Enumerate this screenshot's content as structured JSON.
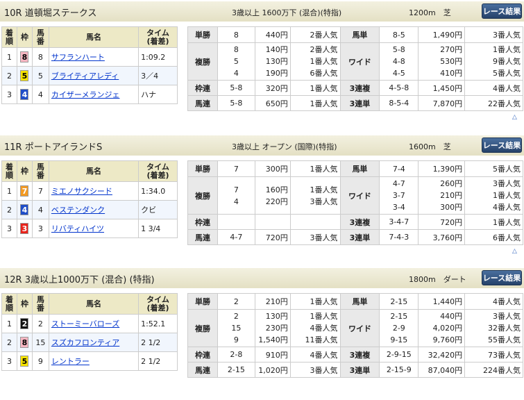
{
  "button_label": "レース結果",
  "races": [
    {
      "title": "10R 道頓堀ステークス",
      "conditions": "3歳以上 1600万下 (混合)(特指)",
      "distance": "1200m　芝",
      "headers": [
        "着順",
        "枠",
        "馬番",
        "馬名",
        "タイム (着差)"
      ],
      "horses": [
        {
          "pos": "1",
          "waku": "8",
          "num": "8",
          "name": "サフランハート",
          "time": "1:09.2"
        },
        {
          "pos": "2",
          "waku": "5",
          "num": "5",
          "name": "ブライティアレディ",
          "time": "3／4"
        },
        {
          "pos": "3",
          "waku": "4",
          "num": "4",
          "name": "カイザーメランジェ",
          "time": "ハナ"
        }
      ],
      "pay": {
        "tansho": {
          "label": "単勝",
          "num": "8",
          "yen": "440円",
          "pop": "2番人気"
        },
        "fukusho": {
          "label": "複勝",
          "nums": [
            "8",
            "5",
            "4"
          ],
          "yens": [
            "140円",
            "130円",
            "190円"
          ],
          "pops": [
            "2番人気",
            "1番人気",
            "6番人気"
          ]
        },
        "wakuren": {
          "label": "枠連",
          "num": "5-8",
          "yen": "320円",
          "pop": "1番人気"
        },
        "umaren": {
          "label": "馬連",
          "num": "5-8",
          "yen": "650円",
          "pop": "1番人気"
        },
        "umatan": {
          "label": "馬単",
          "num": "8-5",
          "yen": "1,490円",
          "pop": "3番人気"
        },
        "wide": {
          "label": "ワイド",
          "nums": [
            "5-8",
            "4-8",
            "4-5"
          ],
          "yens": [
            "270円",
            "530円",
            "410円"
          ],
          "pops": [
            "1番人気",
            "9番人気",
            "5番人気"
          ]
        },
        "sanrenpuku": {
          "label": "3連複",
          "num": "4-5-8",
          "yen": "1,450円",
          "pop": "4番人気"
        },
        "sanrentan": {
          "label": "3連単",
          "num": "8-5-4",
          "yen": "7,870円",
          "pop": "22番人気"
        }
      }
    },
    {
      "title": "11R ポートアイランドS",
      "conditions": "3歳以上 オープン (国際)(特指)",
      "distance": "1600m　芝",
      "headers": [
        "着順",
        "枠",
        "馬番",
        "馬名",
        "タイム (着差)"
      ],
      "horses": [
        {
          "pos": "1",
          "waku": "7",
          "num": "7",
          "name": "ミエノサクシード",
          "time": "1:34.0"
        },
        {
          "pos": "2",
          "waku": "4",
          "num": "4",
          "name": "ベステンダンク",
          "time": "クビ"
        },
        {
          "pos": "3",
          "waku": "3",
          "num": "3",
          "name": "リバティハイツ",
          "time": "1 3/4"
        }
      ],
      "pay": {
        "tansho": {
          "label": "単勝",
          "num": "7",
          "yen": "300円",
          "pop": "1番人気"
        },
        "fukusho": {
          "label": "複勝",
          "nums": [
            "7",
            "4"
          ],
          "yens": [
            "160円",
            "220円"
          ],
          "pops": [
            "1番人気",
            "3番人気"
          ]
        },
        "wakuren": {
          "label": "枠連",
          "num": "",
          "yen": "",
          "pop": ""
        },
        "umaren": {
          "label": "馬連",
          "num": "4-7",
          "yen": "720円",
          "pop": "3番人気"
        },
        "umatan": {
          "label": "馬単",
          "num": "7-4",
          "yen": "1,390円",
          "pop": "5番人気"
        },
        "wide": {
          "label": "ワイド",
          "nums": [
            "4-7",
            "3-7",
            "3-4"
          ],
          "yens": [
            "260円",
            "210円",
            "300円"
          ],
          "pops": [
            "3番人気",
            "1番人気",
            "4番人気"
          ]
        },
        "sanrenpuku": {
          "label": "3連複",
          "num": "3-4-7",
          "yen": "720円",
          "pop": "1番人気"
        },
        "sanrentan": {
          "label": "3連単",
          "num": "7-4-3",
          "yen": "3,760円",
          "pop": "6番人気"
        }
      }
    },
    {
      "title": "12R 3歳以上1000万下 (混合) (特指)",
      "conditions": "",
      "distance": "1800m　ダート",
      "headers": [
        "着順",
        "枠",
        "馬番",
        "馬名",
        "タイム (着差)"
      ],
      "horses": [
        {
          "pos": "1",
          "waku": "2",
          "num": "2",
          "name": "ストーミーバローズ",
          "time": "1:52.1"
        },
        {
          "pos": "2",
          "waku": "8",
          "num": "15",
          "name": "スズカフロンティア",
          "time": "2 1/2"
        },
        {
          "pos": "3",
          "waku": "5",
          "num": "9",
          "name": "レントラー",
          "time": "2 1/2"
        }
      ],
      "pay": {
        "tansho": {
          "label": "単勝",
          "num": "2",
          "yen": "210円",
          "pop": "1番人気"
        },
        "fukusho": {
          "label": "複勝",
          "nums": [
            "2",
            "15",
            "9"
          ],
          "yens": [
            "130円",
            "230円",
            "1,540円"
          ],
          "pops": [
            "1番人気",
            "4番人気",
            "11番人気"
          ]
        },
        "wakuren": {
          "label": "枠連",
          "num": "2-8",
          "yen": "910円",
          "pop": "4番人気"
        },
        "umaren": {
          "label": "馬連",
          "num": "2-15",
          "yen": "1,020円",
          "pop": "3番人気"
        },
        "umatan": {
          "label": "馬単",
          "num": "2-15",
          "yen": "1,440円",
          "pop": "4番人気"
        },
        "wide": {
          "label": "ワイド",
          "nums": [
            "2-15",
            "2-9",
            "9-15"
          ],
          "yens": [
            "440円",
            "4,020円",
            "9,760円"
          ],
          "pops": [
            "3番人気",
            "32番人気",
            "55番人気"
          ]
        },
        "sanrenpuku": {
          "label": "3連複",
          "num": "2-9-15",
          "yen": "32,420円",
          "pop": "73番人気"
        },
        "sanrentan": {
          "label": "3連単",
          "num": "2-15-9",
          "yen": "87,040円",
          "pop": "224番人気"
        }
      }
    }
  ],
  "waku_colors": {
    "1": {
      "bg": "#ffffff",
      "fg": "#000000"
    },
    "2": {
      "bg": "#111111",
      "fg": "#ffffff"
    },
    "3": {
      "bg": "#e8231b",
      "fg": "#ffffff"
    },
    "4": {
      "bg": "#1f4ec8",
      "fg": "#ffffff"
    },
    "5": {
      "bg": "#f6e300",
      "fg": "#000000"
    },
    "6": {
      "bg": "#2f9e46",
      "fg": "#ffffff"
    },
    "7": {
      "bg": "#f39a23",
      "fg": "#ffffff"
    },
    "8": {
      "bg": "#f7b6c2",
      "fg": "#000000"
    }
  }
}
